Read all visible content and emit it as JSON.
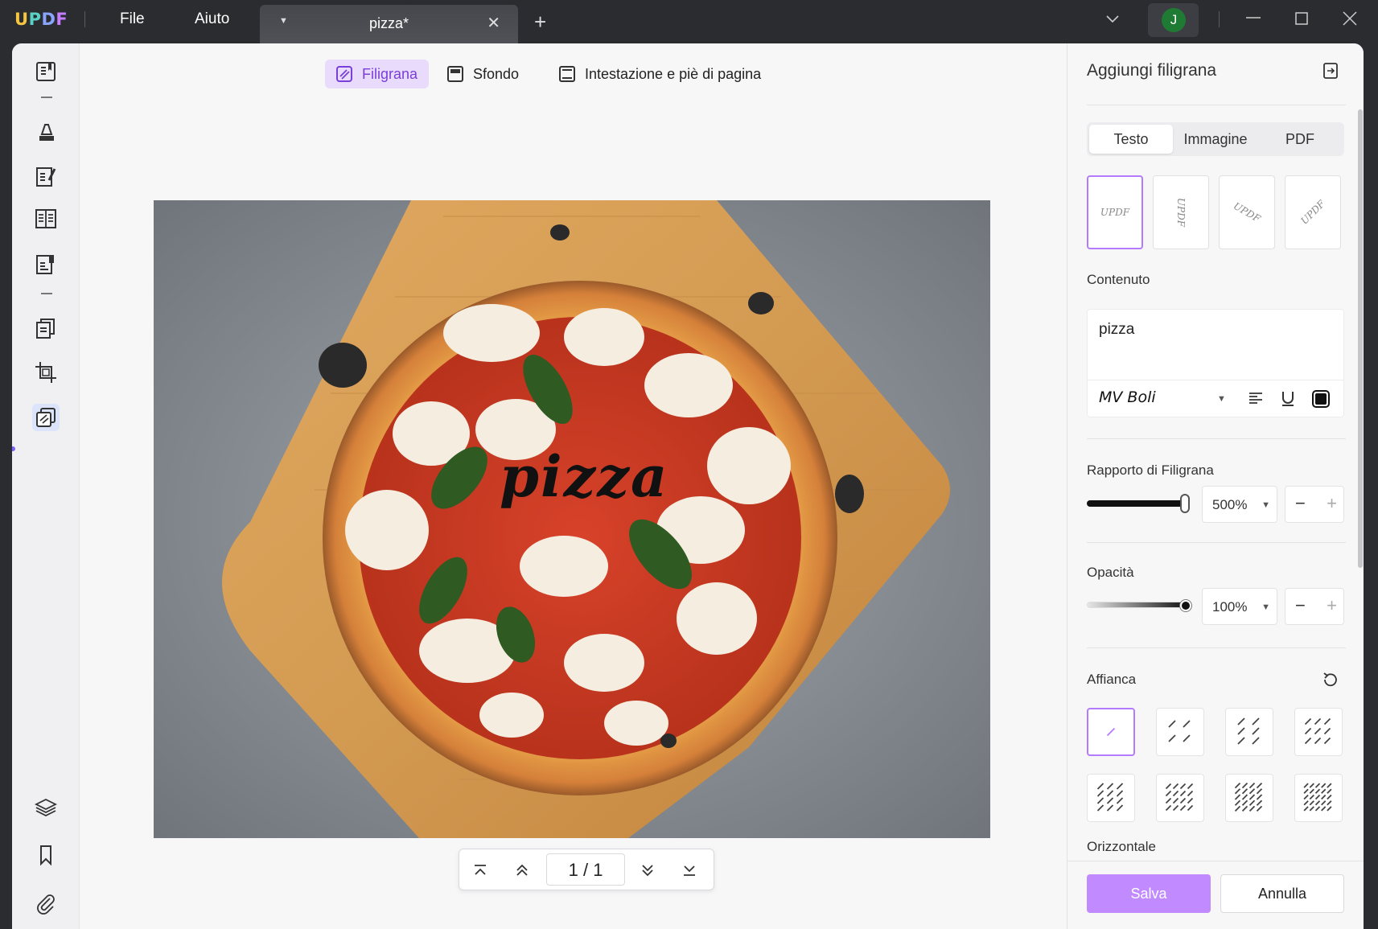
{
  "app": {
    "logo": "UPDF"
  },
  "menu": {
    "file": "File",
    "help": "Aiuto"
  },
  "tab": {
    "title": "pizza*"
  },
  "user": {
    "avatar_letter": "J"
  },
  "toolbar": {
    "watermark": "Filigrana",
    "background": "Sfondo",
    "header_footer": "Intestazione e piè di pagina"
  },
  "document": {
    "watermark_text": "pizza",
    "image_subject": "pizza"
  },
  "pager": {
    "current": "1",
    "sep": "/",
    "total": "1"
  },
  "panel": {
    "title": "Aggiungi filigrana",
    "source_tabs": [
      "Testo",
      "Immagine",
      "PDF"
    ],
    "preset_text": "UPDF",
    "content_label": "Contenuto",
    "content_value": "pizza",
    "font": "MV Boli",
    "ratio_label": "Rapporto di Filigrana",
    "ratio_value": "500%",
    "opacity_label": "Opacità",
    "opacity_value": "100%",
    "tile_label": "Affianca",
    "orientation_label": "Orizzontale",
    "save": "Salva",
    "cancel": "Annulla"
  },
  "colors": {
    "accent": "#c18aff",
    "active_bg": "#e9dbfb",
    "titlebar": "#2b2c30"
  }
}
